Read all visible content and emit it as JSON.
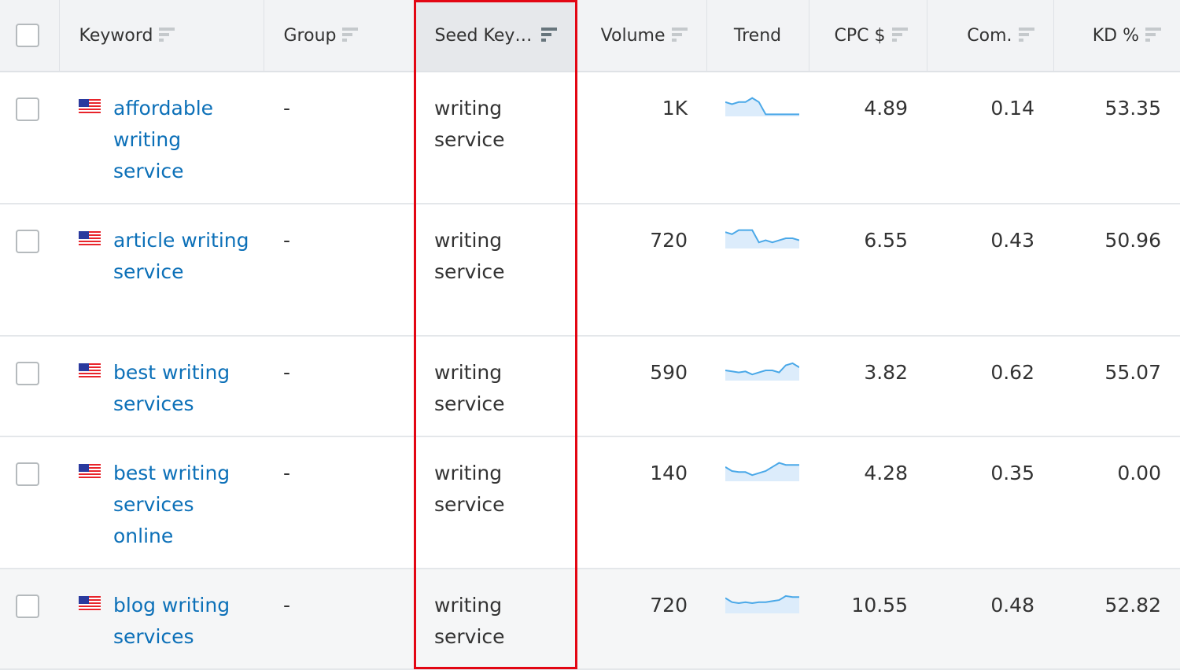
{
  "header": {
    "select_all_checked": false,
    "columns": [
      {
        "key": "keyword",
        "label": "Keyword",
        "sortable": true
      },
      {
        "key": "group",
        "label": "Group",
        "sortable": true
      },
      {
        "key": "seed",
        "label": "Seed Key…",
        "sortable": true,
        "active": true
      },
      {
        "key": "volume",
        "label": "Volume",
        "sortable": true
      },
      {
        "key": "trend",
        "label": "Trend",
        "sortable": false
      },
      {
        "key": "cpc",
        "label": "CPC $",
        "sortable": true
      },
      {
        "key": "com",
        "label": "Com.",
        "sortable": true
      },
      {
        "key": "kd",
        "label": "KD %",
        "sortable": true
      }
    ]
  },
  "rows": [
    {
      "keyword": "affordable writing service",
      "flag": "us-flag",
      "group": "-",
      "seed": "writing service",
      "volume": "1K",
      "trend": [
        7,
        6,
        7,
        7,
        9,
        7,
        1,
        1,
        1,
        1,
        1,
        1
      ],
      "cpc": "4.89",
      "com": "0.14",
      "kd": "53.35"
    },
    {
      "keyword": "article writing service",
      "flag": "us-flag",
      "group": "-",
      "seed": "writing service",
      "volume": "720",
      "trend": [
        8,
        7,
        9,
        9,
        9,
        3,
        4,
        3,
        4,
        5,
        5,
        4
      ],
      "cpc": "6.55",
      "com": "0.43",
      "kd": "50.96"
    },
    {
      "keyword": "best writing services",
      "flag": "us-flag",
      "group": "-",
      "seed": "writing service",
      "volume": "590",
      "trend": [
        5,
        4.5,
        4,
        4.5,
        3,
        4,
        5,
        5,
        4,
        7.5,
        8.5,
        6.5
      ],
      "cpc": "3.82",
      "com": "0.62",
      "kd": "55.07"
    },
    {
      "keyword": "best writing services online",
      "flag": "us-flag",
      "group": "-",
      "seed": "writing service",
      "volume": "140",
      "trend": [
        7,
        5,
        4.5,
        4.5,
        3,
        4,
        5,
        7,
        9,
        8,
        8,
        8
      ],
      "cpc": "4.28",
      "com": "0.35",
      "kd": "0.00"
    },
    {
      "keyword": "blog writing services",
      "flag": "us-flag",
      "group": "-",
      "seed": "writing service",
      "volume": "720",
      "trend": [
        7.5,
        5.5,
        5,
        5.5,
        5,
        5.5,
        5.5,
        6,
        6.5,
        8.5,
        8,
        8
      ],
      "cpc": "10.55",
      "com": "0.48",
      "kd": "52.82"
    }
  ],
  "highlight": {
    "column": "seed",
    "color": "#e30613"
  },
  "colors": {
    "link": "#0c70b8",
    "trend_line": "#4aa8e8",
    "trend_fill": "#dcecfb",
    "header_bg": "#f2f3f5",
    "active_header_bg": "#e6e8eb"
  }
}
